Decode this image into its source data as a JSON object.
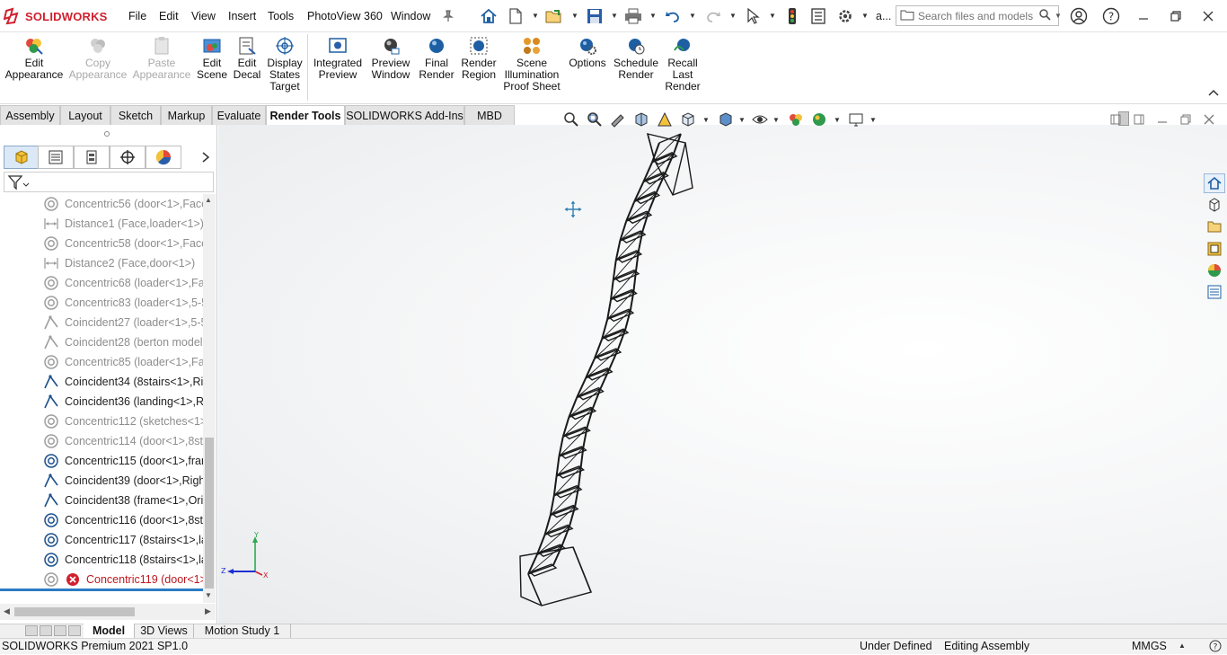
{
  "app": {
    "brand": "SOLIDWORKS",
    "brand_color": "#d0202e"
  },
  "menu": [
    "File",
    "Edit",
    "View",
    "Insert",
    "Tools",
    "PhotoView 360",
    "Window"
  ],
  "search": {
    "placeholder": "Search files and models",
    "user_label": "a..."
  },
  "ribbon": [
    {
      "label": "Edit\nAppearance",
      "enabled": true
    },
    {
      "label": "Copy\nAppearance",
      "enabled": false
    },
    {
      "label": "Paste\nAppearance",
      "enabled": false
    },
    {
      "label": "Edit\nScene",
      "enabled": true
    },
    {
      "label": "Edit\nDecal",
      "enabled": true
    },
    {
      "label": "Display\nStates\nTarget",
      "enabled": true
    },
    {
      "label": "Integrated\nPreview",
      "enabled": true
    },
    {
      "label": "Preview\nWindow",
      "enabled": true
    },
    {
      "label": "Final\nRender",
      "enabled": true
    },
    {
      "label": "Render\nRegion",
      "enabled": true
    },
    {
      "label": "Scene\nIllumination\nProof Sheet",
      "enabled": true
    },
    {
      "label": "Options",
      "enabled": true
    },
    {
      "label": "Schedule\nRender",
      "enabled": true
    },
    {
      "label": "Recall\nLast\nRender",
      "enabled": true
    }
  ],
  "tabs": [
    "Assembly",
    "Layout",
    "Sketch",
    "Markup",
    "Evaluate",
    "Render Tools",
    "SOLIDWORKS Add-Ins",
    "MBD"
  ],
  "active_tab": "Render Tools",
  "tree": [
    {
      "icon": "concentric",
      "text": "Concentric56 (door<1>,Face",
      "state": "dim"
    },
    {
      "icon": "distance",
      "text": "Distance1 (Face,loader<1>)",
      "state": "dim"
    },
    {
      "icon": "concentric",
      "text": "Concentric58 (door<1>,Face",
      "state": "dim"
    },
    {
      "icon": "distance",
      "text": "Distance2 (Face,door<1>)",
      "state": "dim"
    },
    {
      "icon": "concentric",
      "text": "Concentric68 (loader<1>,Fac",
      "state": "dim"
    },
    {
      "icon": "concentric",
      "text": "Concentric83 (loader<1>,5-5",
      "state": "dim"
    },
    {
      "icon": "coincident",
      "text": "Coincident27 (loader<1>,5-5",
      "state": "dim"
    },
    {
      "icon": "coincident",
      "text": "Coincident28 (berton model-",
      "state": "dim"
    },
    {
      "icon": "concentric",
      "text": "Concentric85 (loader<1>,Fac",
      "state": "dim"
    },
    {
      "icon": "coincident",
      "text": "Coincident34 (8stairs<1>,Rig",
      "state": "normal"
    },
    {
      "icon": "coincident",
      "text": "Coincident36 (landing<1>,Ri",
      "state": "normal"
    },
    {
      "icon": "concentric",
      "text": "Concentric112 (sketches<1>,",
      "state": "dim"
    },
    {
      "icon": "concentric",
      "text": "Concentric114 (door<1>,8sta",
      "state": "dim"
    },
    {
      "icon": "concentric",
      "text": "Concentric115 (door<1>,fran",
      "state": "normal"
    },
    {
      "icon": "coincident",
      "text": "Coincident39 (door<1>,Righ",
      "state": "normal"
    },
    {
      "icon": "coincident",
      "text": "Coincident38 (frame<1>,Orig",
      "state": "normal"
    },
    {
      "icon": "concentric",
      "text": "Concentric116 (door<1>,8sta",
      "state": "normal"
    },
    {
      "icon": "concentric",
      "text": "Concentric117 (8stairs<1>,la",
      "state": "normal"
    },
    {
      "icon": "concentric",
      "text": "Concentric118 (8stairs<1>,la",
      "state": "normal"
    },
    {
      "icon": "error",
      "text": "Concentric119 (door<1>,",
      "state": "err"
    }
  ],
  "triad": {
    "x": "X",
    "y": "Y",
    "z": "Z"
  },
  "bottom_tabs": [
    "Model",
    "3D Views",
    "Motion Study 1"
  ],
  "active_bottom_tab": "Model",
  "status": {
    "product": "SOLIDWORKS Premium 2021 SP1.0",
    "definition": "Under Defined",
    "mode": "Editing Assembly",
    "units": "MMGS"
  },
  "colors": {
    "accent": "#2b7bc4",
    "error": "#c0181f",
    "dim_text": "#8d8d8d"
  }
}
